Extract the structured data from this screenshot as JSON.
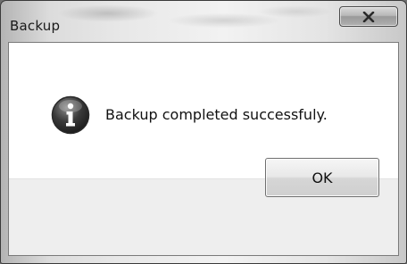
{
  "window": {
    "title": "Backup"
  },
  "title_bar": {
    "close_icon": "close-x-icon"
  },
  "dialog": {
    "icon": "info-icon",
    "message": "Backup completed successfuly."
  },
  "buttons": {
    "ok_label": "OK"
  },
  "colors": {
    "info_icon_fill": "#3a3a3a",
    "footer_background": "#eeeeee",
    "content_background": "#ffffff"
  }
}
